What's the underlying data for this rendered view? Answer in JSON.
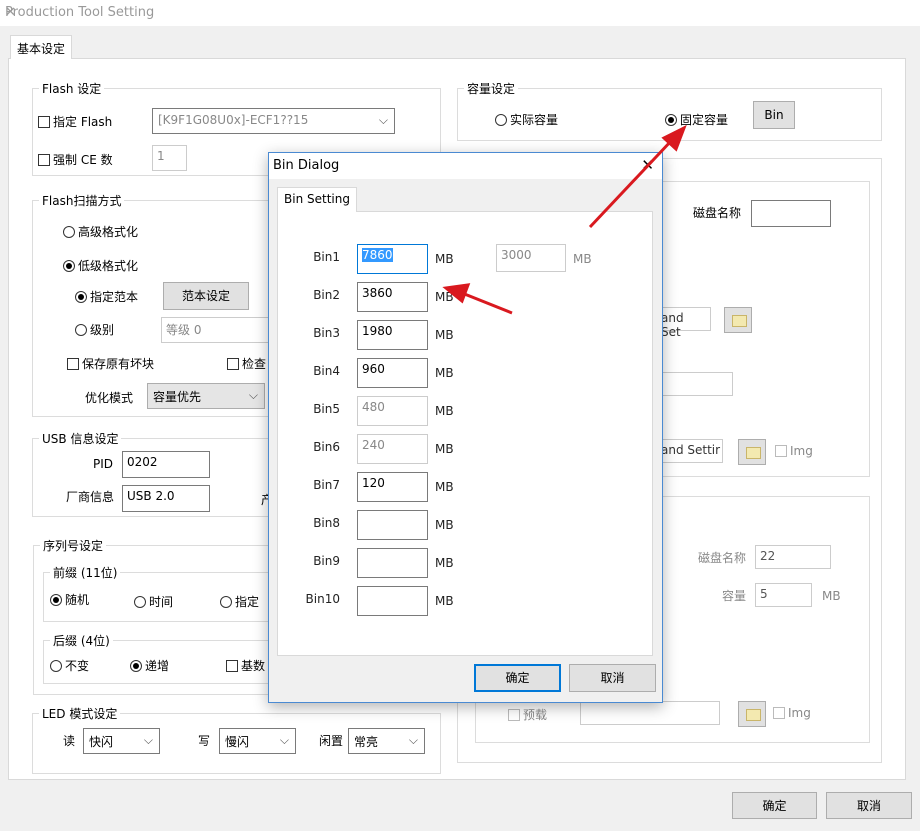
{
  "window": {
    "title": "Production Tool Setting",
    "close": "✕"
  },
  "tab": "基本设定",
  "flash": {
    "legend": "Flash 设定",
    "specify_flash": "指定 Flash",
    "flash_value": "[K9F1G08U0x]-ECF1??15",
    "force_ce": "强制 CE 数",
    "ce_value": "1"
  },
  "scan": {
    "legend": "Flash扫描方式",
    "high_format": "高级格式化",
    "low_format": "低级格式化",
    "specify_sample": "指定范本",
    "sample_setting": "范本设定",
    "level": "级别",
    "level_value": "等级 0",
    "keep_bad": "保存原有坏块",
    "check": "检查",
    "opt_mode_label": "优化模式",
    "opt_mode_value": "容量优先"
  },
  "usb": {
    "legend": "USB 信息设定",
    "pid_label": "PID",
    "pid_value": "0202",
    "vendor_label": "厂商信息",
    "vendor_value": "USB 2.0",
    "product_partial": "产"
  },
  "serial": {
    "legend": "序列号设定",
    "prefix_legend": "前缀 (11位)",
    "random": "随机",
    "time": "时间",
    "specify": "指定",
    "suffix_legend": "后缀 (4位)",
    "unchanged": "不变",
    "increment": "递增",
    "odd": "基数"
  },
  "led": {
    "legend": "LED 模式设定",
    "read_label": "读",
    "read_value": "快闪",
    "write_label": "写",
    "write_value": "慢闪",
    "idle_label": "闲置",
    "idle_value": "常亮"
  },
  "capacity": {
    "legend": "容量设定",
    "actual": "实际容量",
    "fixed": "固定容量",
    "bin_button": "Bin"
  },
  "right": {
    "disk_name_label": "磁盘名称",
    "disk_name_value": "",
    "cmd1": "and Set",
    "cmd2": "and Settir",
    "img": "Img",
    "disk_name_label2": "磁盘名称",
    "disk_name_value2": "22",
    "cap_label": "容量",
    "cap_value": "5",
    "cap_unit": "MB",
    "preload": "预载",
    "img2": "Img"
  },
  "dialog": {
    "title": "Bin Dialog",
    "close": "✕",
    "tab": "Bin Setting",
    "unit": "MB",
    "extra_value": "3000",
    "extra_unit": "MB",
    "ok": "确定",
    "cancel": "取消",
    "bins": [
      {
        "label": "Bin1",
        "value": "7860"
      },
      {
        "label": "Bin2",
        "value": "3860"
      },
      {
        "label": "Bin3",
        "value": "1980"
      },
      {
        "label": "Bin4",
        "value": "960"
      },
      {
        "label": "Bin5",
        "value": "480"
      },
      {
        "label": "Bin6",
        "value": "240"
      },
      {
        "label": "Bin7",
        "value": "120"
      },
      {
        "label": "Bin8",
        "value": ""
      },
      {
        "label": "Bin9",
        "value": ""
      },
      {
        "label": "Bin10",
        "value": ""
      }
    ]
  },
  "footer": {
    "ok": "确定",
    "cancel": "取消"
  },
  "colors": {
    "accent": "#0078d7",
    "arrow": "#d9191f"
  }
}
